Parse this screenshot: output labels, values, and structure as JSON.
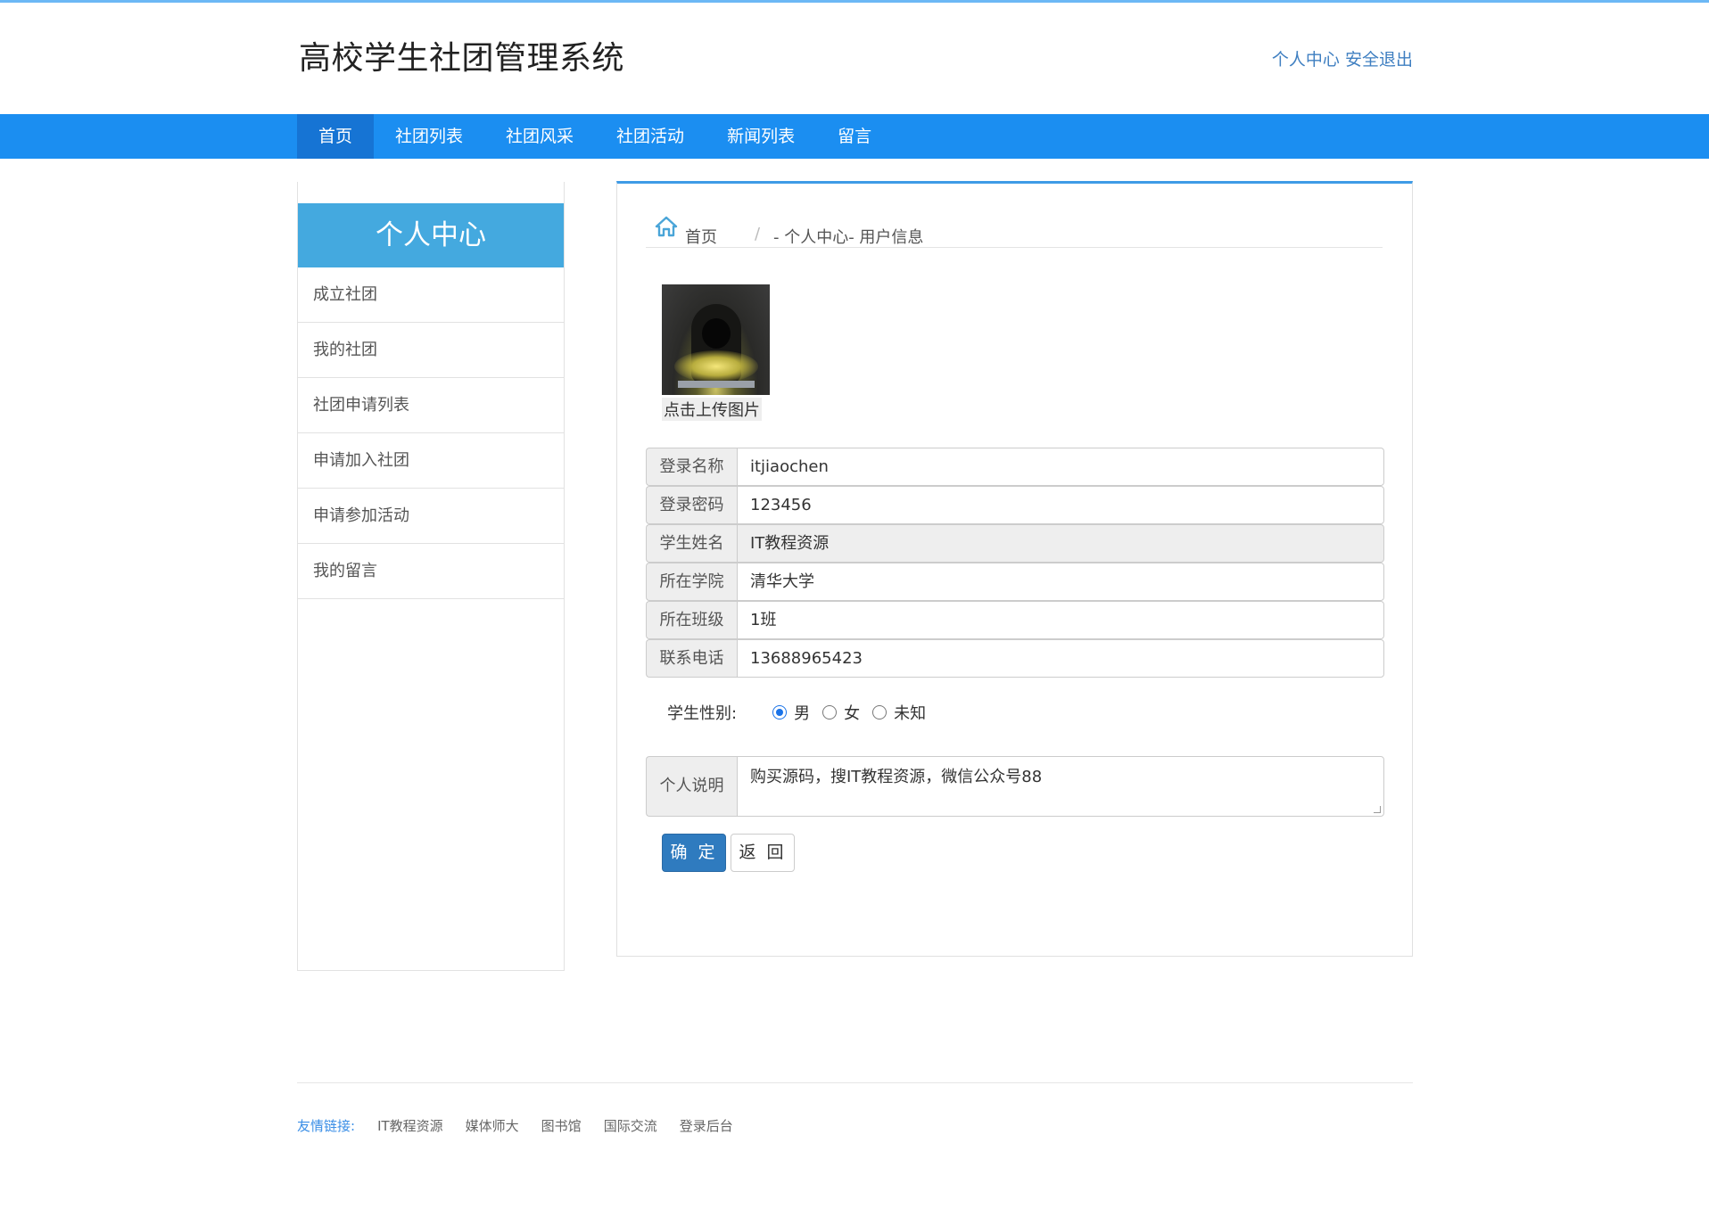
{
  "header": {
    "brand": "高校学生社团管理系统",
    "links": [
      "个人中心",
      "安全退出"
    ]
  },
  "nav": {
    "items": [
      "首页",
      "社团列表",
      "社团风采",
      "社团活动",
      "新闻列表",
      "留言"
    ]
  },
  "sidebar": {
    "title": "个人中心",
    "items": [
      "成立社团",
      "我的社团",
      "社团申请列表",
      "申请加入社团",
      "申请参加活动",
      "我的留言"
    ]
  },
  "breadcrumb": {
    "home": "首页",
    "separator": "/",
    "current": "- 个人中心- 用户信息"
  },
  "profile": {
    "upload_label": "点击上传图片",
    "fields": [
      {
        "label": "登录名称",
        "value": "itjiaochen"
      },
      {
        "label": "登录密码",
        "value": "123456"
      },
      {
        "label": "学生姓名",
        "value": "IT教程资源"
      },
      {
        "label": "所在学院",
        "value": "清华大学"
      },
      {
        "label": "所在班级",
        "value": "1班"
      },
      {
        "label": "联系电话",
        "value": "13688965423"
      }
    ],
    "gender_label": "学生性别:",
    "gender_options": [
      "男",
      "女",
      "未知"
    ],
    "gender_selected": "男",
    "desc_label": "个人说明",
    "desc_value": "购买源码，搜IT教程资源，微信公众号88",
    "confirm_label": "确 定",
    "back_label": "返 回"
  },
  "footer": {
    "label": "友情链接:",
    "links": [
      "IT教程资源",
      "媒体师大",
      "图书馆",
      "国际交流",
      "登录后台"
    ]
  },
  "colors": {
    "nav_bg": "#1b8ef1",
    "nav_active": "#1674d4",
    "sidebar_head": "#44a9df",
    "primary_button": "#2f7bbf"
  }
}
